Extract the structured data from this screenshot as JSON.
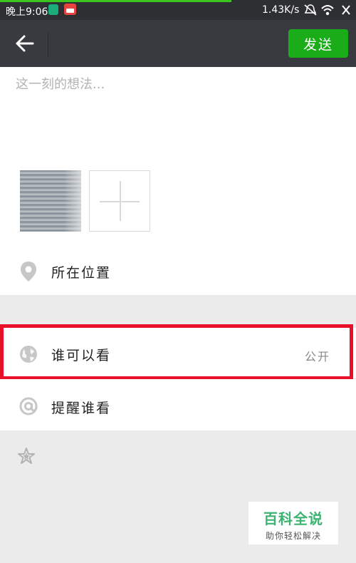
{
  "status_bar": {
    "time": "晚上9:06",
    "network_speed": "1.43K/s",
    "progress": 0.65
  },
  "toolbar": {
    "back_icon": "arrow-left-icon",
    "send_label": "发送"
  },
  "compose": {
    "placeholder": "这一刻的想法...",
    "value": ""
  },
  "options": {
    "location_label": "所在位置",
    "visibility_label": "谁可以看",
    "visibility_value": "公开",
    "remind_label": "提醒谁看"
  },
  "watermark": {
    "title": "百科全说",
    "subtitle": "助你轻松解决"
  },
  "colors": {
    "accent_green": "#1aad19",
    "toolbar_bg": "#393a3f",
    "highlight_red": "#e8102a"
  }
}
